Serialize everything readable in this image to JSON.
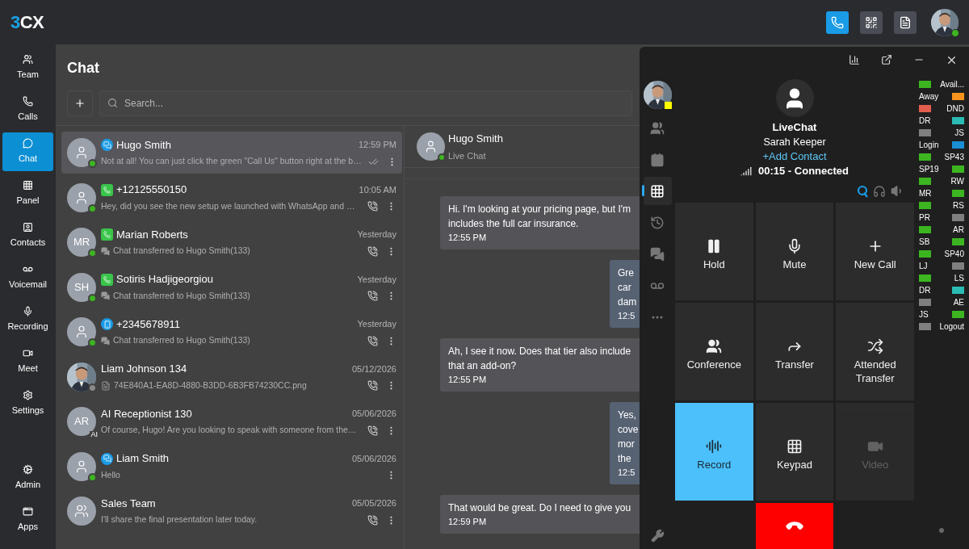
{
  "logo": {
    "accent": "3",
    "rest": "CX"
  },
  "topbar_buttons": [
    {
      "selected": true
    },
    {
      "selected": false
    },
    {
      "selected": false
    }
  ],
  "user_online": true,
  "nav": [
    {
      "label": "Team",
      "selected": false
    },
    {
      "label": "Calls",
      "selected": false
    },
    {
      "label": "Chat",
      "selected": true
    },
    {
      "label": "Panel",
      "selected": false
    },
    {
      "label": "Contacts",
      "selected": false
    },
    {
      "label": "Voicemail",
      "selected": false
    },
    {
      "label": "Recording",
      "selected": false
    },
    {
      "label": "Meet",
      "selected": false
    },
    {
      "label": "Settings",
      "selected": false
    }
  ],
  "nav_bottom": [
    {
      "label": "Admin"
    },
    {
      "label": "Apps"
    }
  ],
  "chat_list": {
    "title": "Chat",
    "search": {
      "placeholder": "Search..."
    },
    "items": [
      {
        "name": "Hugo Smith",
        "time": "12:59 PM",
        "preview": "Not at all! You can just click the green \"Call Us\" button right at the b…",
        "selected": true,
        "avatar": {
          "kind": "person"
        },
        "online": true,
        "channel": {
          "kind": "livechat"
        },
        "action": {
          "kind": "read"
        }
      },
      {
        "name": "+12125550150",
        "time": "10:05 AM",
        "preview": "Hey, did you see the new setup we launched with WhatsApp and …",
        "selected": false,
        "avatar": {
          "kind": "person"
        },
        "online": true,
        "channel": {
          "kind": "whatsapp"
        },
        "action": {
          "kind": "call"
        }
      },
      {
        "name": "Marian Roberts",
        "time": "Yesterday",
        "preview": "Chat transferred to Hugo Smith(133)",
        "selected": false,
        "avatar": {
          "kind": "initials",
          "initials": "MR"
        },
        "online": true,
        "channel": {
          "kind": "whatsapp"
        },
        "preview_icon": {
          "kind": "transfer"
        },
        "action": {
          "kind": "call"
        }
      },
      {
        "name": "Sotiris Hadjigeorgiou",
        "time": "Yesterday",
        "preview": "Chat transferred to Hugo Smith(133)",
        "selected": false,
        "avatar": {
          "kind": "initials",
          "initials": "SH"
        },
        "online": true,
        "channel": {
          "kind": "whatsapp"
        },
        "preview_icon": {
          "kind": "transfer"
        },
        "action": {
          "kind": "call"
        }
      },
      {
        "name": "+2345678911",
        "time": "Yesterday",
        "preview": "Chat transferred to Hugo Smith(133)",
        "selected": false,
        "avatar": {
          "kind": "person"
        },
        "online": true,
        "channel": {
          "kind": "sms"
        },
        "preview_icon": {
          "kind": "transfer"
        },
        "action": {
          "kind": "call"
        }
      },
      {
        "name": "Liam Johnson 134",
        "time": "05/12/2026",
        "preview": "74E840A1-EA8D-4880-B3DD-6B3FB74230CC.png",
        "selected": false,
        "online": false,
        "preview_icon": {
          "kind": "file"
        },
        "action": {
          "kind": "call"
        }
      },
      {
        "name": "AI Receptionist 130",
        "time": "05/06/2026",
        "preview": "Of course, Hugo! Are you looking to speak with someone from the…",
        "selected": false,
        "avatar": {
          "kind": "initials",
          "initials": "AR"
        },
        "badge": "AI",
        "action": {
          "kind": "call"
        }
      },
      {
        "name": "Liam Smith",
        "time": "05/06/2026",
        "preview": "Hello",
        "selected": false,
        "avatar": {
          "kind": "person"
        },
        "online": true,
        "channel": {
          "kind": "livechat"
        }
      },
      {
        "name": "Sales Team",
        "time": "05/05/2026",
        "preview": "I'll share the final presentation later today.",
        "selected": false,
        "avatar": {
          "kind": "group"
        },
        "action": {
          "kind": "call"
        }
      }
    ]
  },
  "conversation": {
    "name": "Hugo Smith",
    "subtitle": "Live Chat",
    "online": true,
    "messages": [
      {
        "kind": "incoming",
        "text": "Hi. I'm looking at your pricing page, but I'm\nincludes the full car insurance.",
        "time": "12:55 PM"
      },
      {
        "kind": "outgoing",
        "text": "Gre\ncar\ndam",
        "time": "12:5"
      },
      {
        "kind": "incoming",
        "text": "Ah, I see it now. Does that tier also include\nthat an add-on?",
        "time": "12:55 PM"
      },
      {
        "kind": "outgoing",
        "text": "Yes,\ncove\nmor\nthe",
        "time": "12:5"
      },
      {
        "kind": "incoming",
        "text": "That would be great. Do I need to give you",
        "time": "12:59 PM"
      }
    ]
  },
  "phone": {
    "busy": true,
    "caller": {
      "title": "LiveChat",
      "name": "Sarah Keeper",
      "add_contact": "+Add Contact",
      "status": "00:15 - Connected"
    },
    "rail": [
      {
        "selected": false
      },
      {
        "selected": false
      },
      {
        "selected": true
      },
      {
        "selected": false
      },
      {
        "selected": false
      },
      {
        "selected": false
      },
      {
        "selected": false
      }
    ],
    "buttons": [
      {
        "kind": "action",
        "label": "Hold",
        "active": false,
        "disabled": false
      },
      {
        "kind": "action",
        "label": "Mute",
        "active": false,
        "disabled": false
      },
      {
        "kind": "action",
        "label": "New Call",
        "active": false,
        "disabled": false
      },
      {
        "kind": "action",
        "label": "Conference",
        "active": false,
        "disabled": false
      },
      {
        "kind": "action",
        "label": "Transfer",
        "active": false,
        "disabled": false
      },
      {
        "kind": "action",
        "label": "Attended Transfer",
        "active": false,
        "disabled": false
      },
      {
        "kind": "action",
        "label": "Record",
        "active": true,
        "disabled": false
      },
      {
        "kind": "action",
        "label": "Keypad",
        "active": false,
        "disabled": false
      },
      {
        "kind": "action",
        "label": "Video",
        "active": false,
        "disabled": true
      },
      {
        "kind": "empty"
      },
      {
        "kind": "hangup"
      },
      {
        "kind": "empty"
      }
    ],
    "blf": [
      {
        "label": "Avail...",
        "color": "#3cb521"
      },
      {
        "label": "Away",
        "color": "#f7941d"
      },
      {
        "label": "DND",
        "color": "#e25d4c"
      },
      {
        "label": "DR",
        "color": "#2bbbb5"
      },
      {
        "label": "JS",
        "color": "#7f7f7f"
      },
      {
        "label": "Login",
        "color": "#1a8fd6"
      },
      {
        "label": "SP43",
        "color": "#3cb521"
      },
      {
        "label": "SP19",
        "color": "#3cb521"
      },
      {
        "label": "RW",
        "color": "#3cb521"
      },
      {
        "label": "MR",
        "color": "#3cb521"
      },
      {
        "label": "RS",
        "color": "#3cb521"
      },
      {
        "label": "PR",
        "color": "#7f7f7f"
      },
      {
        "label": "AR",
        "color": "#3cb521"
      },
      {
        "label": "SB",
        "color": "#3cb521"
      },
      {
        "label": "SP40",
        "color": "#3cb521"
      },
      {
        "label": "LJ",
        "color": "#7f7f7f"
      },
      {
        "label": "LS",
        "color": "#3cb521"
      },
      {
        "label": "DR",
        "color": "#2bbbb5"
      },
      {
        "label": "AE",
        "color": "#7f7f7f"
      },
      {
        "label": "JS",
        "color": "#3cb521"
      },
      {
        "label": "Logout",
        "color": "#7f7f7f"
      }
    ]
  }
}
